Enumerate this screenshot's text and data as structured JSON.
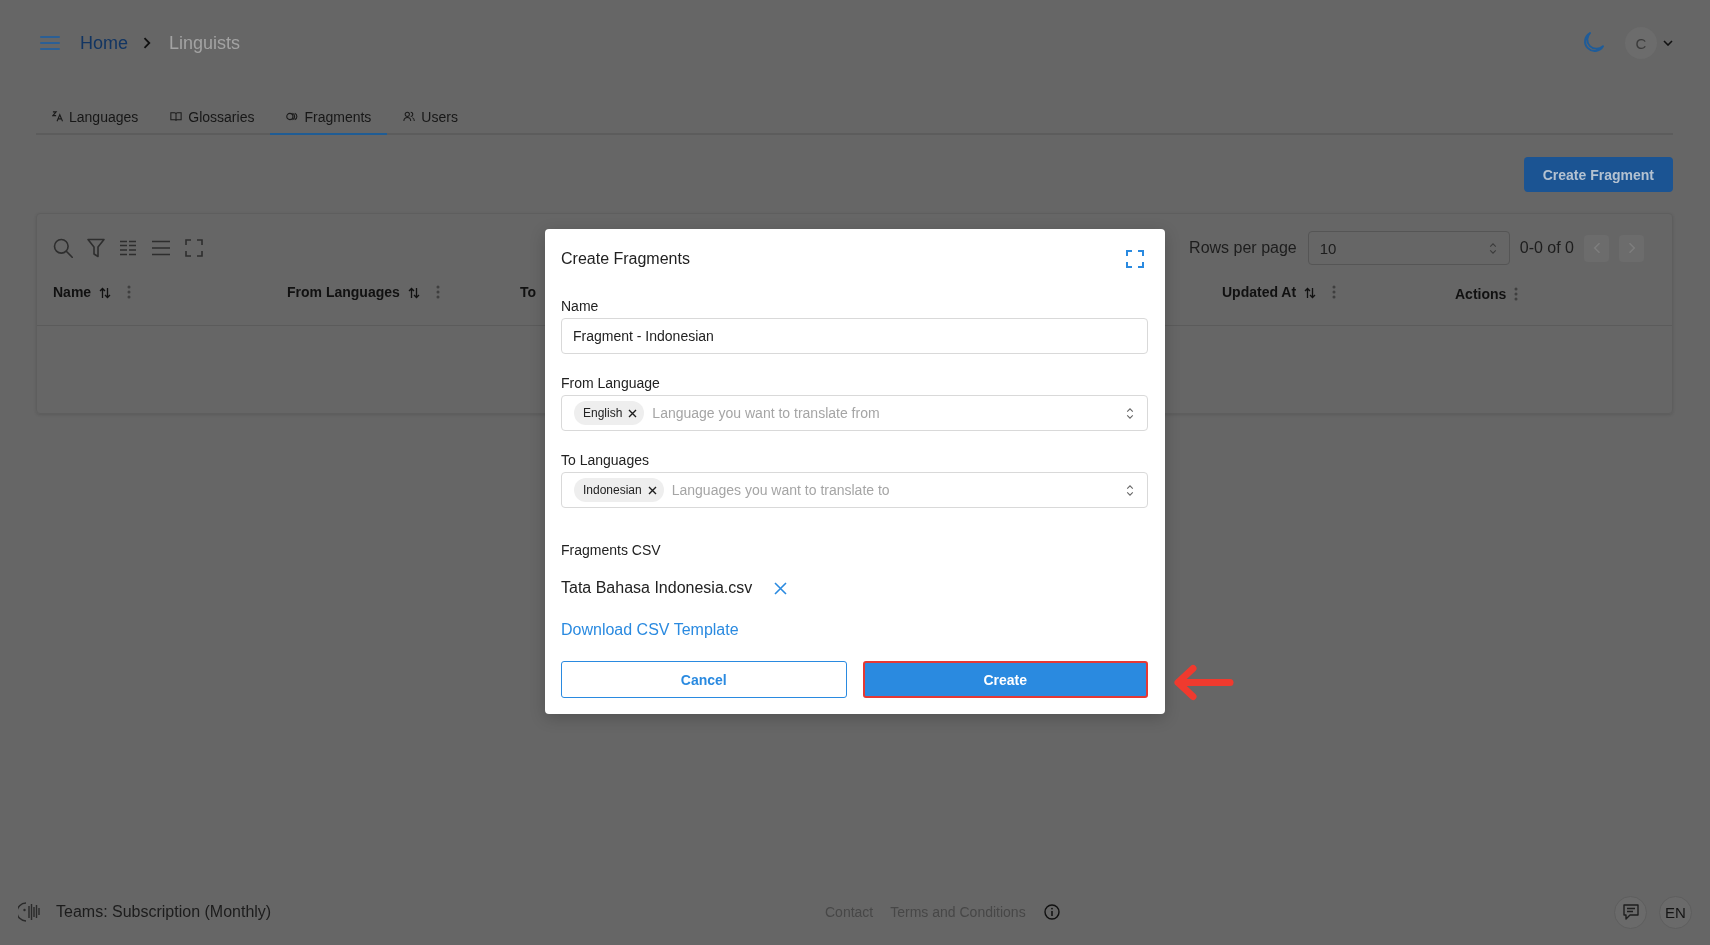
{
  "header": {
    "breadcrumb": [
      {
        "label": "Home",
        "kind": "link"
      },
      {
        "label": "Linguists",
        "kind": "current"
      }
    ],
    "avatar": "C"
  },
  "tabs": [
    {
      "label": "Languages",
      "kind": "languages",
      "selected": false
    },
    {
      "label": "Glossaries",
      "kind": "glossaries",
      "selected": false
    },
    {
      "label": "Fragments",
      "kind": "fragments",
      "selected": true
    },
    {
      "label": "Users",
      "kind": "users",
      "selected": false
    }
  ],
  "create_button": "Create Fragment",
  "table": {
    "pagination": {
      "label": "Rows per page",
      "rows_per_page": "10",
      "range": "0-0 of 0",
      "prev": {
        "disabled": true
      },
      "next": {
        "disabled": true
      }
    },
    "columns": [
      {
        "label": "Name",
        "kind": "sortable"
      },
      {
        "label": "From Languages",
        "kind": "sortable"
      },
      {
        "label": "To",
        "kind": "plain"
      },
      {
        "label": "Updated At",
        "kind": "sortable"
      },
      {
        "label": "Actions",
        "kind": "menu"
      }
    ]
  },
  "dialog": {
    "title": "Create Fragments",
    "fields": [
      {
        "kind": "text",
        "label": "Name",
        "value": "Fragment - Indonesian"
      },
      {
        "kind": "multiselect",
        "label": "From Language",
        "chips": [
          "English"
        ],
        "placeholder": "Language you want to translate from"
      },
      {
        "kind": "multiselect",
        "label": "To Languages",
        "chips": [
          "Indonesian"
        ],
        "placeholder": "Languages you want to translate to"
      }
    ],
    "file": {
      "label": "Fragments CSV",
      "name": "Tata Bahasa Indonesia.csv"
    },
    "template_link": "Download CSV Template",
    "buttons": [
      {
        "label": "Cancel",
        "kind": "outline",
        "highlighted": false
      },
      {
        "label": "Create",
        "kind": "primary",
        "highlighted": true
      }
    ]
  },
  "footer": {
    "plan": "Teams: Subscription (Monthly)",
    "links": [
      "Contact",
      "Terms and Conditions"
    ],
    "language": "EN"
  }
}
